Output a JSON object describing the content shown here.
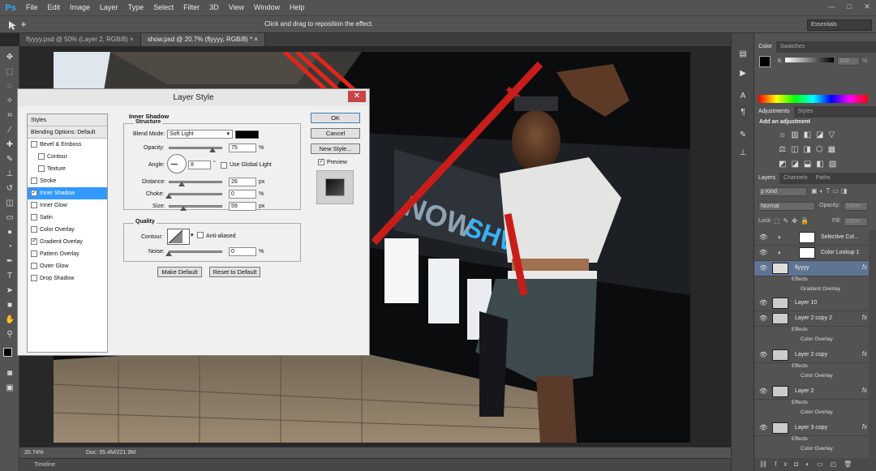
{
  "app": {
    "logo": "Ps"
  },
  "menu": [
    "File",
    "Edit",
    "Image",
    "Layer",
    "Type",
    "Select",
    "Filter",
    "3D",
    "View",
    "Window",
    "Help"
  ],
  "window_controls": [
    "—",
    "□",
    "✕"
  ],
  "options_bar": {
    "hint": "Click and drag to reposition the effect.",
    "workspace": "Essentials"
  },
  "tabs": [
    {
      "label": "flyyyy.psd @ 50% (Layer 2, RGB/8)",
      "close": "×"
    },
    {
      "label": "show.psd @ 20.7% (flyyyy, RGB/8) *",
      "close": "×"
    }
  ],
  "status": {
    "zoom": "20.74%",
    "doc": "Doc: 55.4M/221.9M",
    "timeline": "Timeline"
  },
  "color_panel": {
    "tabs": [
      "Color",
      "Swatches"
    ],
    "channel": "K",
    "value": "100",
    "unit": "%"
  },
  "adjust_panel": {
    "tabs": [
      "Adjustments",
      "Styles"
    ],
    "title": "Add an adjustment"
  },
  "layers_panel": {
    "tabs": [
      "Layers",
      "Channels",
      "Paths"
    ],
    "kind": "ρ Kind",
    "blend": "Normal",
    "opacity_label": "Opacity:",
    "opacity_value": "100%",
    "lock_label": "Lock:",
    "fill_label": "Fill:",
    "fill_value": "100%",
    "layers": [
      {
        "name": "Selective Col...",
        "type": "adj"
      },
      {
        "name": "Color Lookup 1",
        "type": "adj"
      },
      {
        "name": "flyyyy",
        "type": "smart",
        "selected": true,
        "effects": [
          "Effects",
          "Gradient Overlay"
        ]
      },
      {
        "name": "Layer 10",
        "type": "pixel"
      },
      {
        "name": "Layer 2 copy 2",
        "type": "pixel",
        "effects": [
          "Effects",
          "Color Overlay"
        ]
      },
      {
        "name": "Layer 2 copy",
        "type": "pixel",
        "effects": [
          "Effects",
          "Color Overlay"
        ]
      },
      {
        "name": "Layer 2",
        "type": "pixel",
        "effects": [
          "Effects",
          "Color Overlay"
        ]
      },
      {
        "name": "Layer 3 copy",
        "type": "pixel",
        "effects": [
          "Effects",
          "Color Overlay"
        ]
      }
    ]
  },
  "dialog": {
    "title": "Layer Style",
    "styles_header": "Styles",
    "blending_options": "Blending Options: Default",
    "style_items": [
      {
        "label": "Bevel & Emboss",
        "checked": false,
        "indent": 0
      },
      {
        "label": "Contour",
        "checked": false,
        "indent": 1
      },
      {
        "label": "Texture",
        "checked": false,
        "indent": 1
      },
      {
        "label": "Stroke",
        "checked": false,
        "indent": 0
      },
      {
        "label": "Inner Shadow",
        "checked": true,
        "indent": 0,
        "selected": true
      },
      {
        "label": "Inner Glow",
        "checked": false,
        "indent": 0
      },
      {
        "label": "Satin",
        "checked": false,
        "indent": 0
      },
      {
        "label": "Color Overlay",
        "checked": false,
        "indent": 0
      },
      {
        "label": "Gradient Overlay",
        "checked": true,
        "indent": 0
      },
      {
        "label": "Pattern Overlay",
        "checked": false,
        "indent": 0
      },
      {
        "label": "Outer Glow",
        "checked": false,
        "indent": 0
      },
      {
        "label": "Drop Shadow",
        "checked": false,
        "indent": 0
      }
    ],
    "section_title": "Inner Shadow",
    "structure_label": "Structure",
    "blend_mode_label": "Blend Mode:",
    "blend_mode_value": "Soft Light",
    "shadow_color": "#000000",
    "opacity_label": "Opacity:",
    "opacity_value": "75",
    "angle_label": "Angle:",
    "angle_value": "8",
    "degree": "°",
    "global_light_label": "Use Global Light",
    "distance_label": "Distance:",
    "distance_value": "26",
    "choke_label": "Choke:",
    "choke_value": "0",
    "size_label": "Size:",
    "size_value": "59",
    "px": "px",
    "pct": "%",
    "quality_label": "Quality",
    "contour_label": "Contour:",
    "anti_aliased_label": "Anti-aliased",
    "noise_label": "Noise:",
    "noise_value": "0",
    "make_default": "Make Default",
    "reset_default": "Reset to Default",
    "ok": "OK",
    "cancel": "Cancel",
    "new_style": "New Style...",
    "preview_label": "Preview",
    "close": "✕"
  }
}
